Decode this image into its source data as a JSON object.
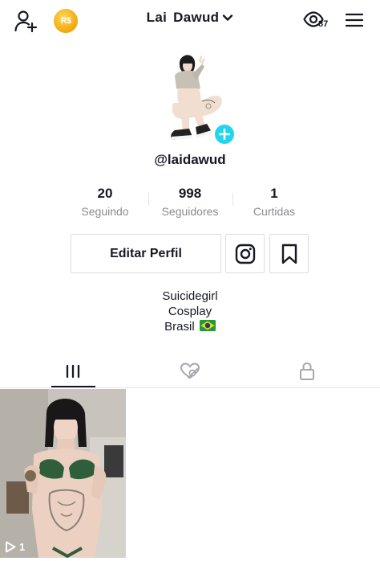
{
  "header": {
    "username_title": "Lai  Dawud",
    "coin_label": "R$",
    "views_count": "87"
  },
  "profile": {
    "handle": "@laidawud",
    "stats": [
      {
        "value": "20",
        "label": "Seguindo"
      },
      {
        "value": "998",
        "label": "Seguidores"
      },
      {
        "value": "1",
        "label": "Curtidas"
      }
    ],
    "edit_button": "Editar Perfil",
    "bio_lines": [
      "Suicidegirl",
      "Cosplay",
      "Brasil"
    ]
  },
  "tabs": [
    "videos-grid",
    "liked",
    "private"
  ],
  "videos": [
    {
      "play_count": "1"
    }
  ],
  "colors": {
    "accent": "#20d5ec",
    "text": "#161823",
    "muted": "#8a8b91"
  }
}
